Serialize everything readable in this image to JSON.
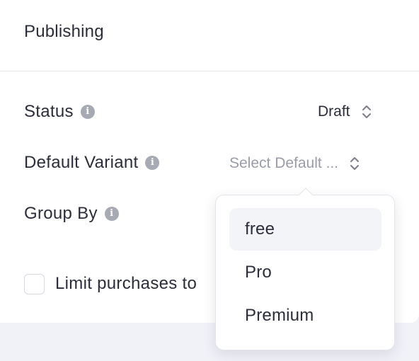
{
  "panel": {
    "title": "Publishing"
  },
  "fields": {
    "status": {
      "label": "Status",
      "value": "Draft"
    },
    "default_variant": {
      "label": "Default Variant",
      "placeholder": "Select Default ..."
    },
    "group_by": {
      "label": "Group By"
    }
  },
  "limit_purchases": {
    "label": "Limit purchases to",
    "checked": false
  },
  "variant_dropdown": {
    "options": [
      "free",
      "Pro",
      "Premium"
    ],
    "highlighted": "free"
  },
  "icons": {
    "info": "info-icon",
    "select_arrows": "chevron-up-down-icon"
  },
  "colors": {
    "text": "#2b2d3a",
    "muted": "#9a9ca7",
    "page_bg": "#f1f2f8"
  }
}
